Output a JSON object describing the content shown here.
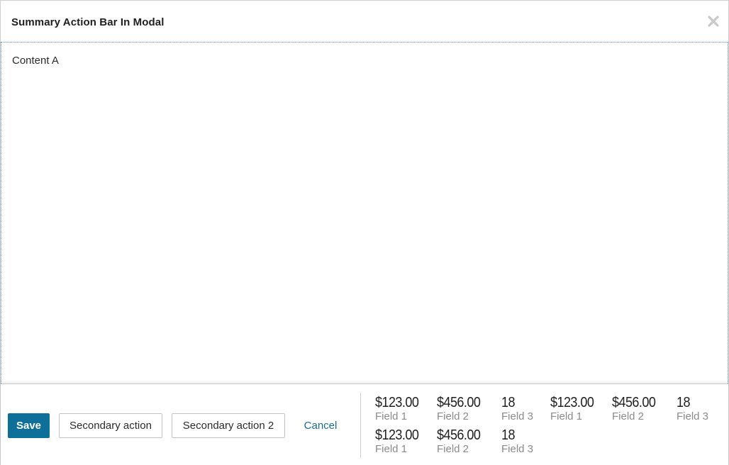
{
  "modal": {
    "title": "Summary Action Bar In Modal",
    "close_icon": "close-icon"
  },
  "body": {
    "content": "Content A"
  },
  "footer": {
    "actions": {
      "save_label": "Save",
      "secondary_label": "Secondary action",
      "secondary2_label": "Secondary action 2",
      "cancel_label": "Cancel"
    },
    "summary": [
      {
        "value": "$123.00",
        "label": "Field 1"
      },
      {
        "value": "$456.00",
        "label": "Field 2"
      },
      {
        "value": "18",
        "label": "Field 3"
      },
      {
        "value": "$123.00",
        "label": "Field 1"
      },
      {
        "value": "$456.00",
        "label": "Field 2"
      },
      {
        "value": "18",
        "label": "Field 3"
      },
      {
        "value": "$123.00",
        "label": "Field 1"
      },
      {
        "value": "$456.00",
        "label": "Field 2"
      },
      {
        "value": "18",
        "label": "Field 3"
      }
    ]
  },
  "colors": {
    "primary": "#0e6f99",
    "link": "#1a6a94",
    "muted_label": "#8a8a8a"
  }
}
